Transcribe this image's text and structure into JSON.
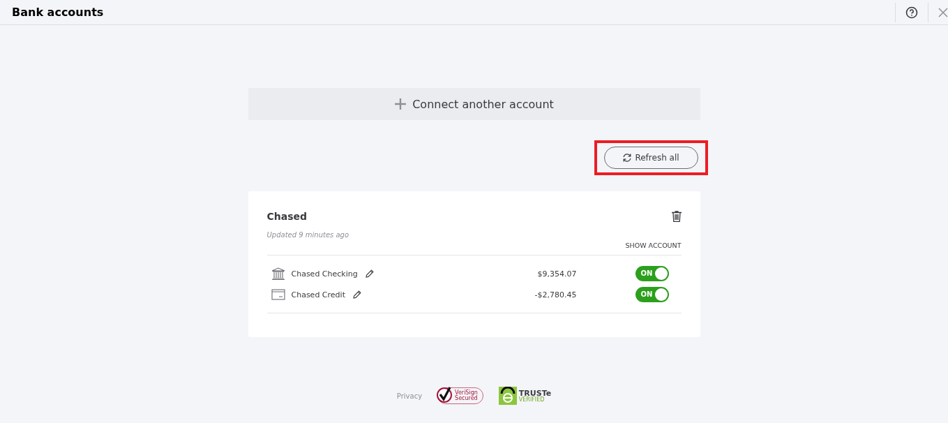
{
  "window": {
    "title": "Bank accounts"
  },
  "connect_button": {
    "label": "Connect another account"
  },
  "refresh_button": {
    "label": "Refresh all",
    "highlighted": true
  },
  "institution": {
    "name": "Chased",
    "updated": "Updated 9 minutes ago",
    "show_account": "SHOW ACCOUNT",
    "accounts": [
      {
        "kind": "bank",
        "name": "Chased Checking",
        "balance": "$9,354.07",
        "on": true,
        "toggle_label": "ON"
      },
      {
        "kind": "card",
        "name": "Chased Credit",
        "balance": "-$2,780.45",
        "on": true,
        "toggle_label": "ON"
      }
    ]
  },
  "footer": {
    "privacy": "Privacy",
    "verisign": [
      "VeriSign",
      "Secured"
    ],
    "truste": [
      "TRUSTe",
      "VERIFIED"
    ]
  }
}
